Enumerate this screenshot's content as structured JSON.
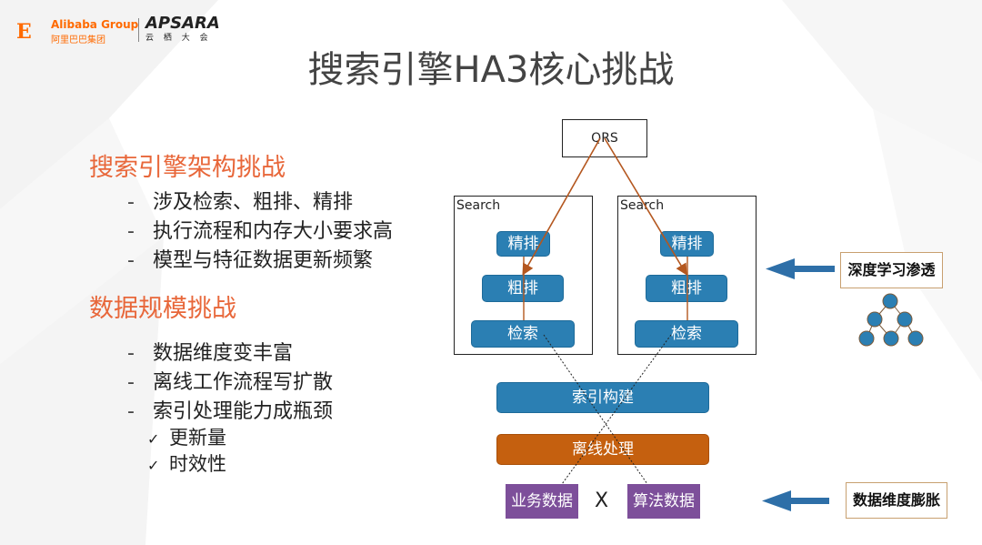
{
  "logos": {
    "alibaba_mark": "E",
    "alibaba_en": "Alibaba Group",
    "alibaba_cn": "阿里巴巴集团",
    "apsara_en": "APSARA",
    "apsara_cn": "云 栖 大 会"
  },
  "title": "搜索引擎HA3核心挑战",
  "left": {
    "section1": {
      "heading": "搜索引擎架构挑战",
      "items": [
        "涉及检索、粗排、精排",
        "执行流程和内存大小要求高",
        "模型与特征数据更新频繁"
      ]
    },
    "section2": {
      "heading": "数据规模挑战",
      "items": [
        "数据维度变丰富",
        "离线工作流程写扩散",
        "索引处理能力成瓶颈"
      ],
      "subitems": [
        "更新量",
        "时效性"
      ]
    },
    "dash": "-",
    "check": "✓"
  },
  "diagram": {
    "qrs": "QRS",
    "search_left": {
      "label": "Search",
      "rank_fine": "精排",
      "rank_coarse": "粗排",
      "retrieval": "检索"
    },
    "search_right": {
      "label": "Search",
      "rank_fine": "精排",
      "rank_coarse": "粗排",
      "retrieval": "检索"
    },
    "index_build": "索引构建",
    "offline": "离线处理",
    "biz_data": "业务数据",
    "cross": "X",
    "algo_data": "算法数据",
    "callout_top": "深度学习渗透",
    "callout_bottom": "数据维度膨胀"
  },
  "colors": {
    "title": "#444444",
    "heading_orange": "#e8673a",
    "pill_blue": "#2b7fb3",
    "pill_orange": "#c5600f",
    "purple": "#7d4f9a",
    "arrow_blue": "#2e6fa8",
    "line_brown": "#b4571f"
  }
}
